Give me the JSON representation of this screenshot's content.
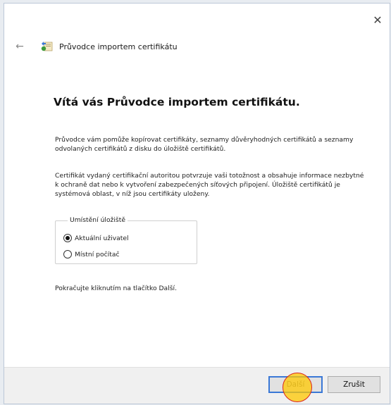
{
  "window": {
    "title": "Průvodce importem certifikátu",
    "close_glyph": "✕",
    "back_glyph": "←"
  },
  "content": {
    "heading": "Vítá vás Průvodce importem certifikátu.",
    "paragraph1": "Průvodce vám pomůže kopírovat certifikáty, seznamy důvěryhodných certifikátů a seznamy odvolaných certifikátů z disku do úložiště certifikátů.",
    "paragraph2": "Certifikát vydaný certifikační autoritou potvrzuje vaši totožnost a obsahuje informace nezbytné k ochraně dat nebo k vytvoření zabezpečených síťových připojení. Úložiště certifikátů je systémová oblast, v níž jsou certifikáty uloženy.",
    "storage_group": {
      "legend": "Umístění úložiště",
      "options": [
        {
          "label": "Aktuální uživatel",
          "checked": true
        },
        {
          "label": "Místní počítač",
          "checked": false
        }
      ]
    },
    "paragraph3": "Pokračujte kliknutím na tlačítko Další."
  },
  "footer": {
    "next_label": "Další",
    "cancel_label": "Zrušit"
  },
  "icons": {
    "back": "back-arrow-icon",
    "wizard": "certificate-wizard-icon",
    "close": "close-icon"
  },
  "colors": {
    "accent": "#3a78d6",
    "click_marker": "#ffc800"
  }
}
